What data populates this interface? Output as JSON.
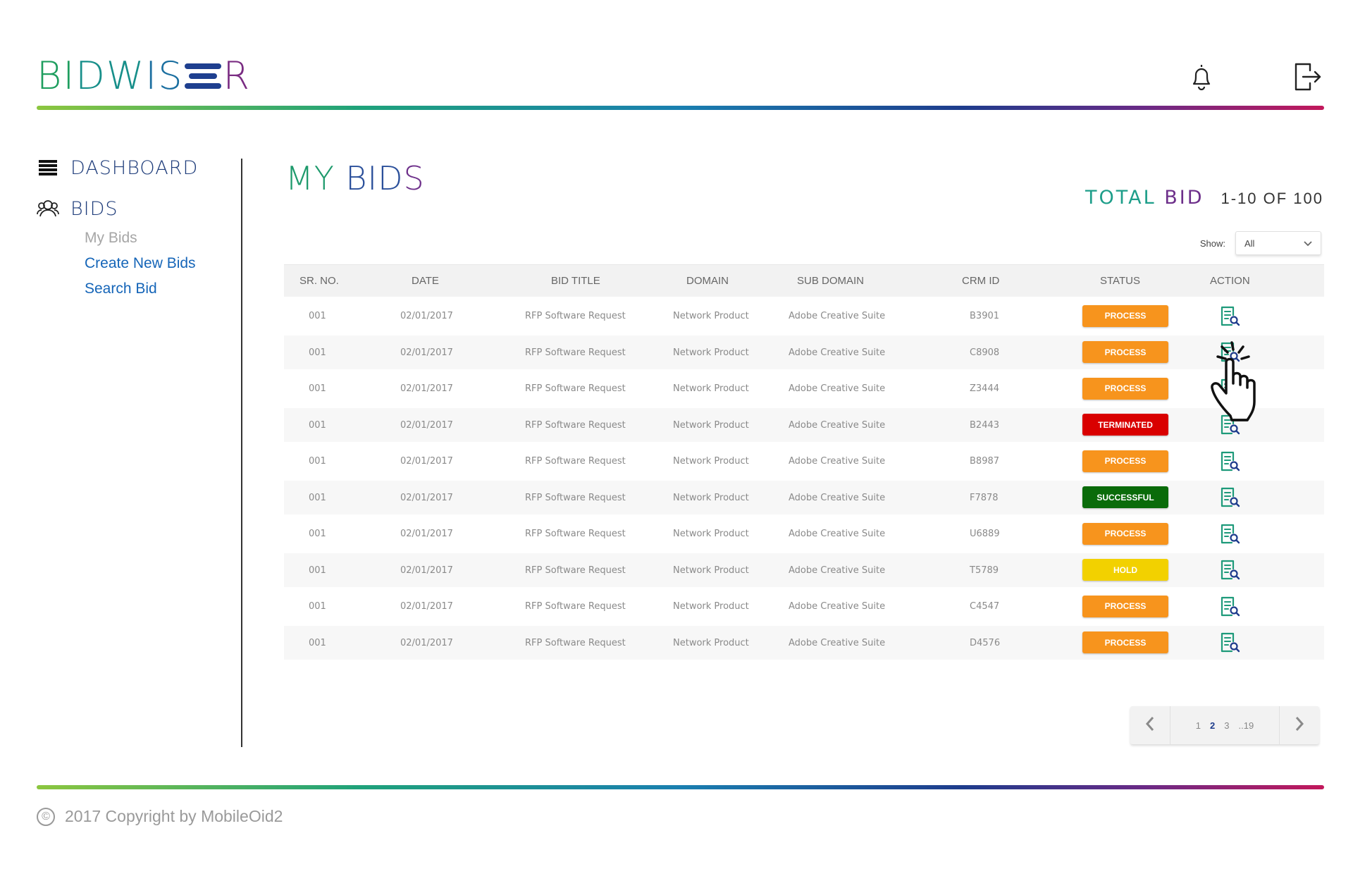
{
  "brand": {
    "p1": "BI",
    "p2": "DW",
    "p3": "IS",
    "p4": "R"
  },
  "header": {
    "notifications_icon": "bell-icon",
    "logout_icon": "logout-icon"
  },
  "sidebar": {
    "dashboard_label": "DASHBOARD",
    "bids_label": "BIDS",
    "sub_items": [
      "My Bids",
      "Create New Bids",
      "Search Bid"
    ]
  },
  "main": {
    "title_a": "MY",
    "title_b": "BID",
    "title_c": "S",
    "total_a": "TOTAL",
    "total_b": "BID",
    "range": "1-10 OF 100",
    "show_label": "Show:",
    "show_value": "All"
  },
  "table": {
    "headers": [
      "SR. NO.",
      "DATE",
      "BID TITLE",
      "DOMAIN",
      "SUB DOMAIN",
      "CRM ID",
      "STATUS",
      "ACTION"
    ],
    "rows": [
      {
        "sr": "001",
        "date": "02/01/2017",
        "title": "RFP Software Request",
        "domain": "Network Product",
        "sub": "Adobe Creative Suite",
        "crm": "B3901",
        "status": "PROCESS"
      },
      {
        "sr": "001",
        "date": "02/01/2017",
        "title": "RFP Software Request",
        "domain": "Network Product",
        "sub": "Adobe Creative Suite",
        "crm": "C8908",
        "status": "PROCESS"
      },
      {
        "sr": "001",
        "date": "02/01/2017",
        "title": "RFP Software Request",
        "domain": "Network Product",
        "sub": "Adobe Creative Suite",
        "crm": "Z3444",
        "status": "PROCESS"
      },
      {
        "sr": "001",
        "date": "02/01/2017",
        "title": "RFP Software Request",
        "domain": "Network Product",
        "sub": "Adobe Creative Suite",
        "crm": "B2443",
        "status": "TERMINATED"
      },
      {
        "sr": "001",
        "date": "02/01/2017",
        "title": "RFP Software Request",
        "domain": "Network Product",
        "sub": "Adobe Creative Suite",
        "crm": "B8987",
        "status": "PROCESS"
      },
      {
        "sr": "001",
        "date": "02/01/2017",
        "title": "RFP Software Request",
        "domain": "Network Product",
        "sub": "Adobe Creative Suite",
        "crm": "F7878",
        "status": "SUCCESSFUL"
      },
      {
        "sr": "001",
        "date": "02/01/2017",
        "title": "RFP Software Request",
        "domain": "Network Product",
        "sub": "Adobe Creative Suite",
        "crm": "U6889",
        "status": "PROCESS"
      },
      {
        "sr": "001",
        "date": "02/01/2017",
        "title": "RFP Software Request",
        "domain": "Network Product",
        "sub": "Adobe Creative Suite",
        "crm": "T5789",
        "status": "HOLD"
      },
      {
        "sr": "001",
        "date": "02/01/2017",
        "title": "RFP Software Request",
        "domain": "Network Product",
        "sub": "Adobe Creative Suite",
        "crm": "C4547",
        "status": "PROCESS"
      },
      {
        "sr": "001",
        "date": "02/01/2017",
        "title": "RFP Software Request",
        "domain": "Network Product",
        "sub": "Adobe Creative Suite",
        "crm": "D4576",
        "status": "PROCESS"
      }
    ],
    "action_icon": "view-document-icon"
  },
  "status_colors": {
    "PROCESS": "#f7941d",
    "TERMINATED": "#d90000",
    "SUCCESSFUL": "#0a6b0a",
    "HOLD": "#f2d100"
  },
  "pagination": {
    "pages": [
      "1",
      "2",
      "3",
      "..19"
    ],
    "current": "2",
    "prev_icon": "chevron-left-icon",
    "next_icon": "chevron-right-icon"
  },
  "footer": {
    "copyright_symbol": "©",
    "text": "2017 Copyright by MobileOid2"
  }
}
